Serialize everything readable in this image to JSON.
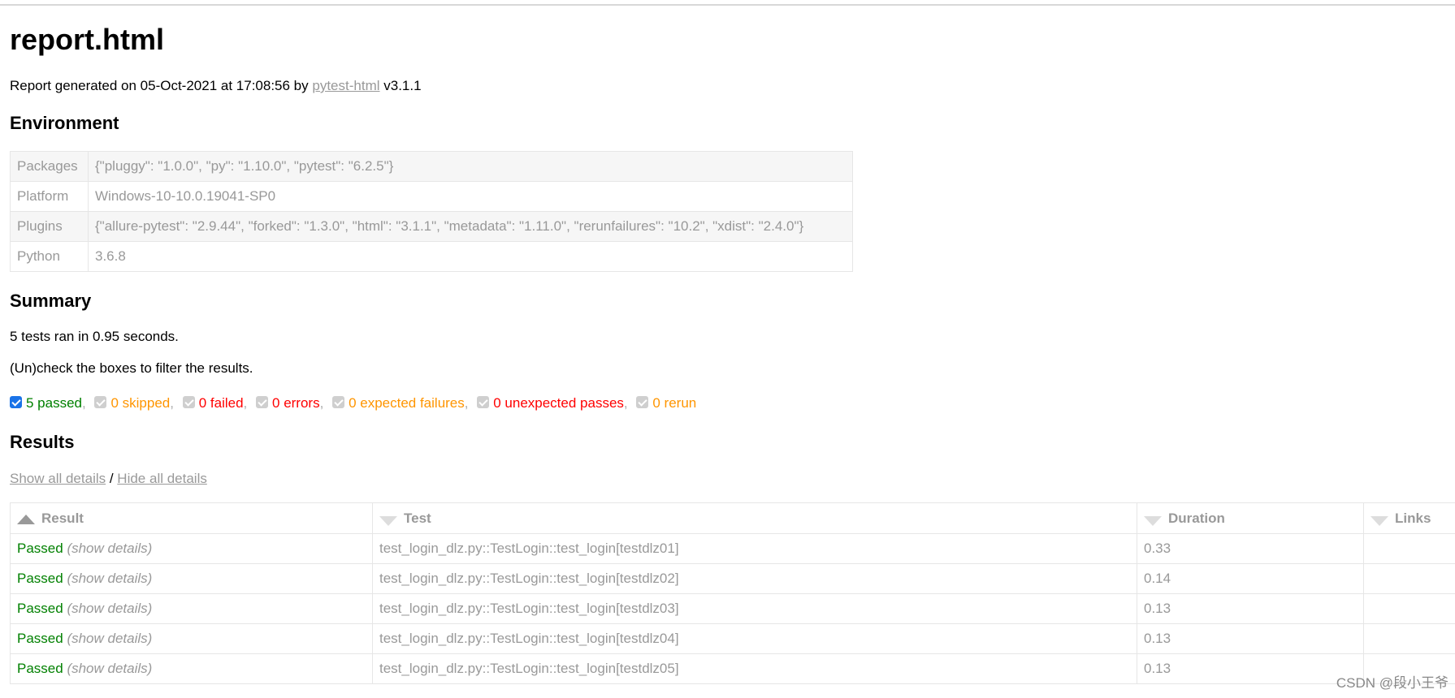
{
  "title": "report.html",
  "generated": {
    "prefix": "Report generated on 05-Oct-2021 at 17:08:56 by ",
    "link": "pytest-html",
    "suffix": " v3.1.1"
  },
  "environment": {
    "heading": "Environment",
    "rows": [
      {
        "key": "Packages",
        "value": "{\"pluggy\": \"1.0.0\", \"py\": \"1.10.0\", \"pytest\": \"6.2.5\"}"
      },
      {
        "key": "Platform",
        "value": "Windows-10-10.0.19041-SP0"
      },
      {
        "key": "Plugins",
        "value": "{\"allure-pytest\": \"2.9.44\", \"forked\": \"1.3.0\", \"html\": \"3.1.1\", \"metadata\": \"1.11.0\", \"rerunfailures\": \"10.2\", \"xdist\": \"2.4.0\"}"
      },
      {
        "key": "Python",
        "value": "3.6.8"
      }
    ]
  },
  "summary": {
    "heading": "Summary",
    "ran": "5 tests ran in 0.95 seconds.",
    "filter_help": "(Un)check the boxes to filter the results.",
    "filters": [
      {
        "label": "5 passed",
        "checked": true
      },
      {
        "label": "0 skipped",
        "checked": false
      },
      {
        "label": "0 failed",
        "checked": false
      },
      {
        "label": "0 errors",
        "checked": false
      },
      {
        "label": "0 expected failures",
        "checked": false
      },
      {
        "label": "0 unexpected passes",
        "checked": false
      },
      {
        "label": "0 rerun",
        "checked": false
      }
    ]
  },
  "results": {
    "heading": "Results",
    "show_all": "Show all details",
    "separator": " / ",
    "hide_all": "Hide all details",
    "columns": [
      "Result",
      "Test",
      "Duration",
      "Links"
    ],
    "rows": [
      {
        "result": "Passed",
        "details": "(show details)",
        "test": "test_login_dlz.py::TestLogin::test_login[testdlz01]",
        "duration": "0.33",
        "links": ""
      },
      {
        "result": "Passed",
        "details": "(show details)",
        "test": "test_login_dlz.py::TestLogin::test_login[testdlz02]",
        "duration": "0.14",
        "links": ""
      },
      {
        "result": "Passed",
        "details": "(show details)",
        "test": "test_login_dlz.py::TestLogin::test_login[testdlz03]",
        "duration": "0.13",
        "links": ""
      },
      {
        "result": "Passed",
        "details": "(show details)",
        "test": "test_login_dlz.py::TestLogin::test_login[testdlz04]",
        "duration": "0.13",
        "links": ""
      },
      {
        "result": "Passed",
        "details": "(show details)",
        "test": "test_login_dlz.py::TestLogin::test_login[testdlz05]",
        "duration": "0.13",
        "links": ""
      }
    ]
  },
  "watermark": "CSDN @段小王爷",
  "colors": {
    "passed": "#008000",
    "skipped": "#ff9500",
    "failed": "#ff0000",
    "checkbox": "#1a73e8"
  }
}
